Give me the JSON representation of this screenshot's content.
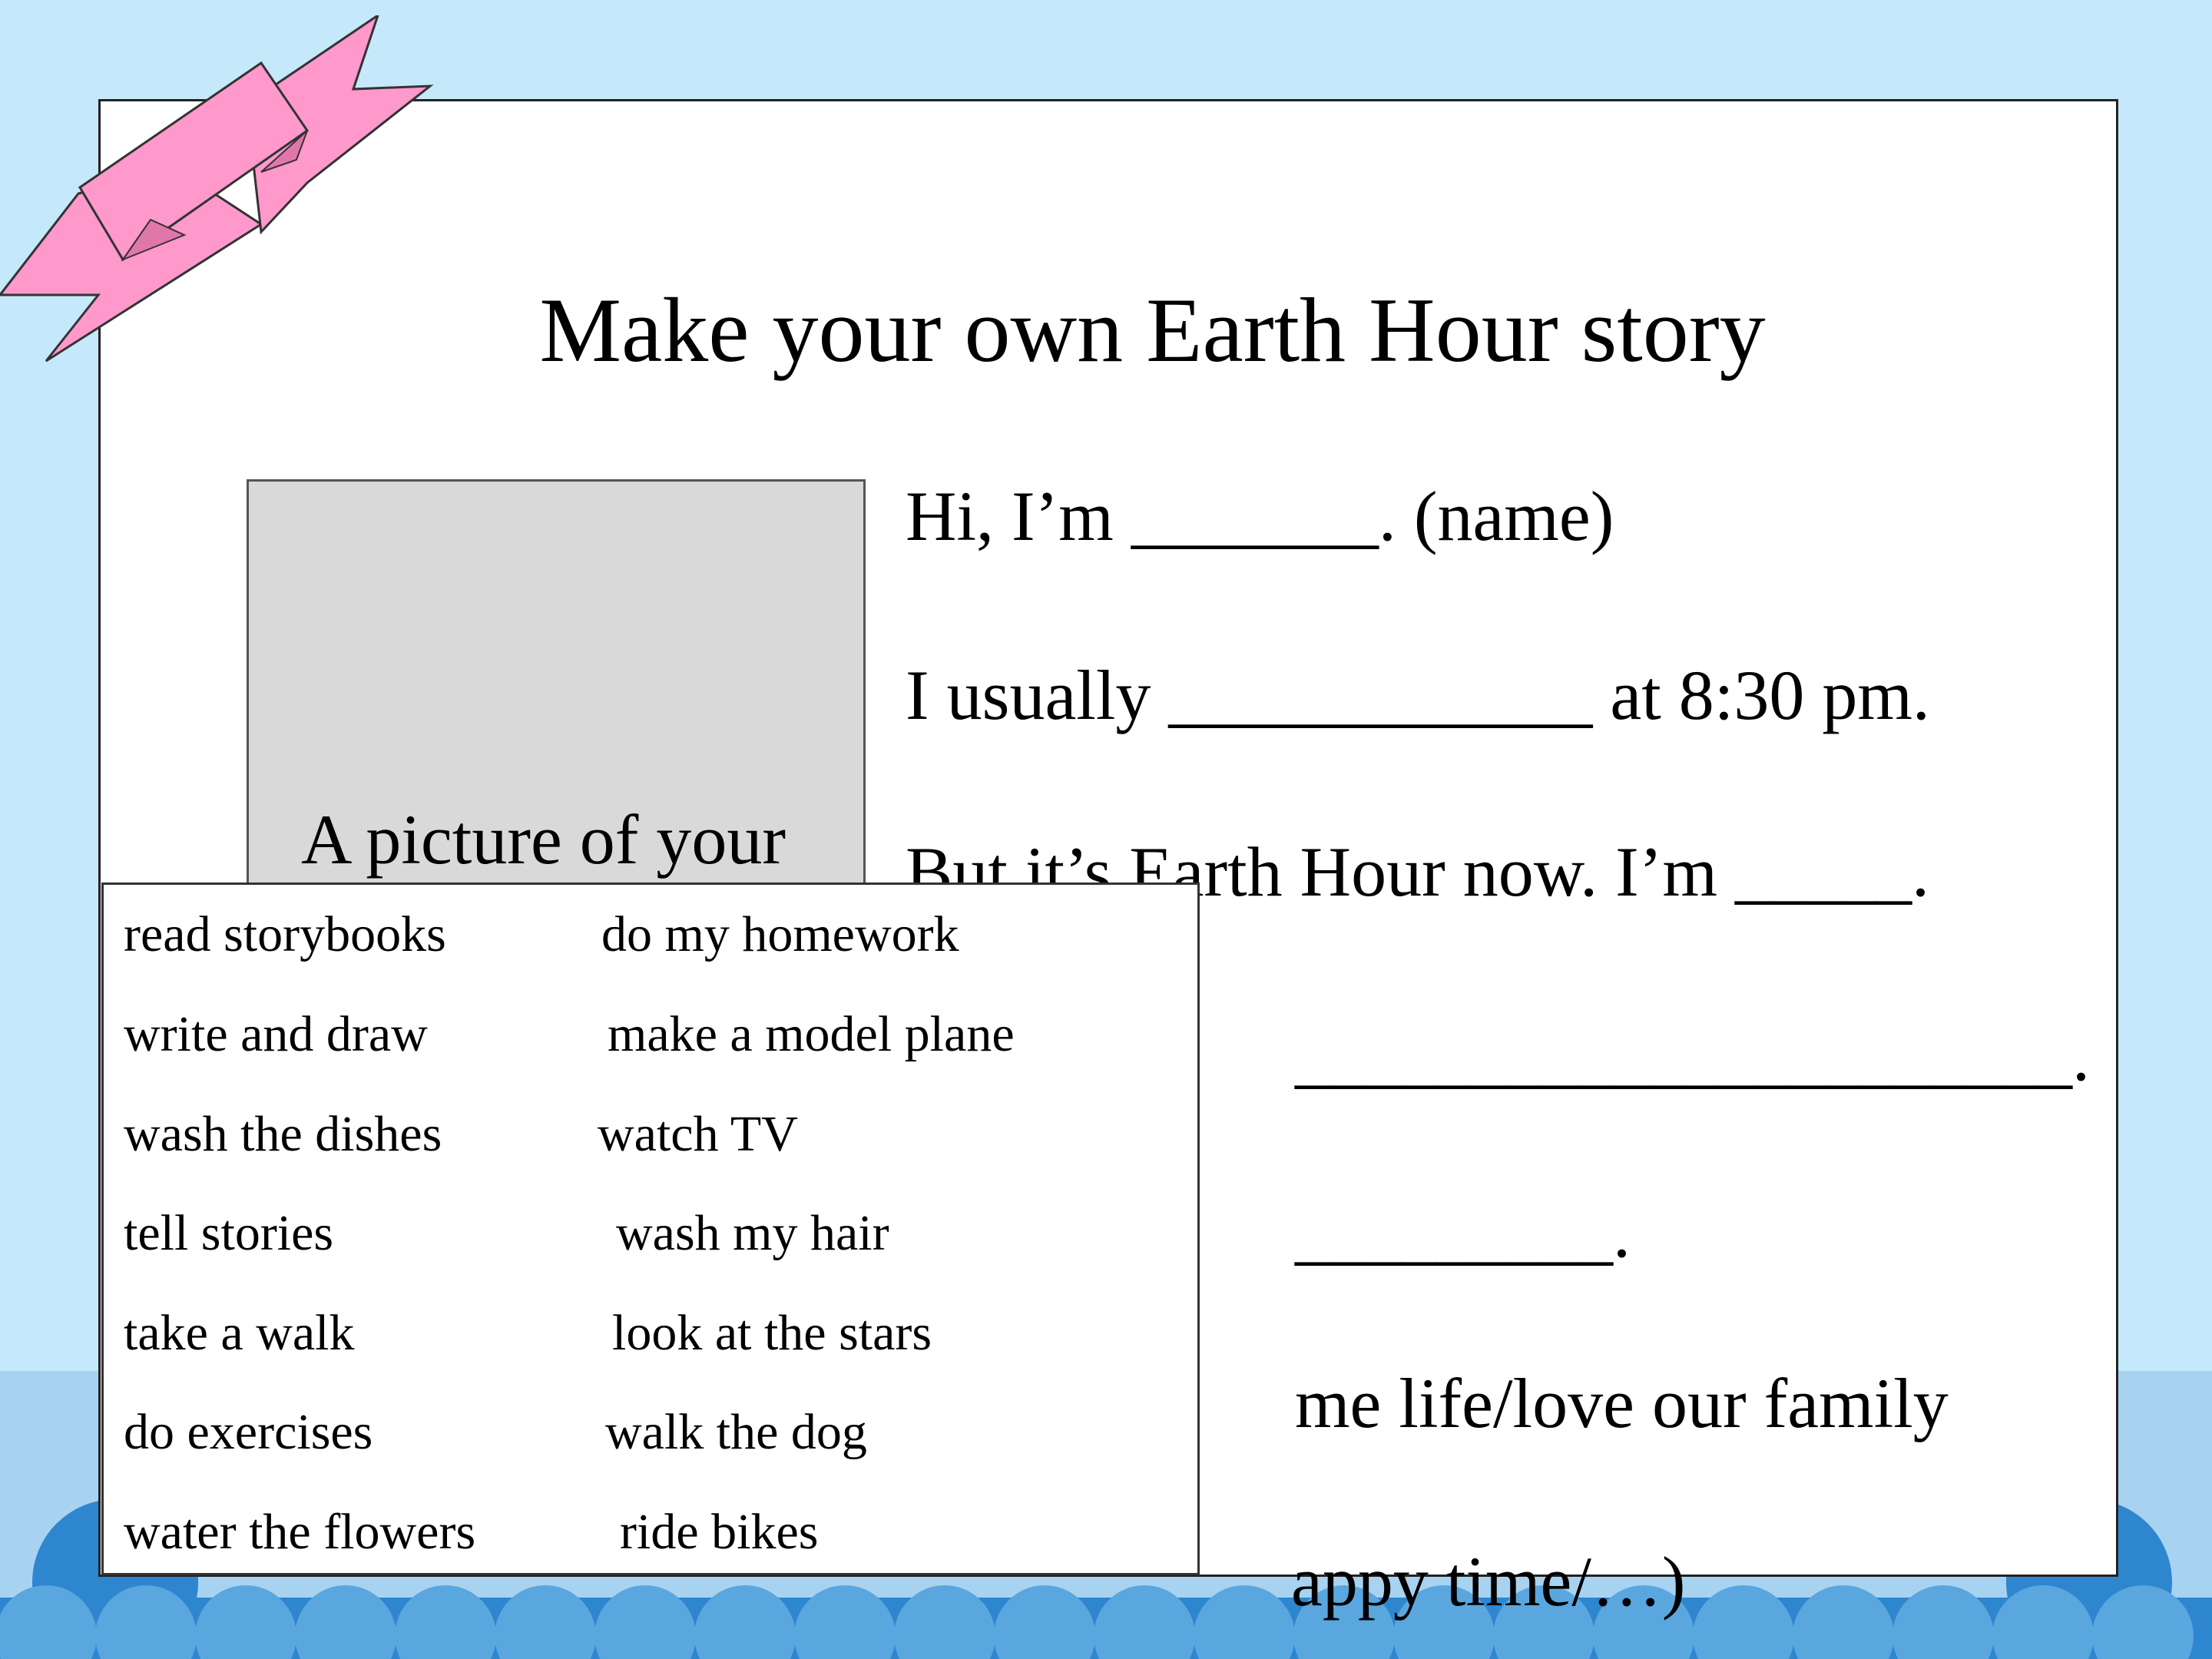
{
  "slide": {
    "title": "Make your own Earth Hour story",
    "picture_caption": "A picture of your family",
    "story_lines": [
      "Hi, I’m _______. (name)",
      "I usually ____________ at 8:30 pm.",
      "But it’s Earth Hour now. I’m _____.",
      "______________________.",
      "_________.",
      "me life/love our family",
      "appy time/…)"
    ]
  },
  "word_bank": {
    "left": [
      "read storybooks",
      "write and draw",
      "wash the dishes",
      "tell stories",
      "take a walk",
      "do exercises",
      "water the flowers"
    ],
    "right": [
      "do my homework",
      "make a model plane",
      "watch TV",
      "wash my hair",
      "look at the stars",
      "walk the dog",
      "ride bikes"
    ]
  },
  "colors": {
    "sky": "#c5e8fa",
    "lower_band": "#a8d3f0",
    "waves": "#2e86cf",
    "ribbon": "#ff99cc",
    "picture_fill": "#d9d9d9"
  }
}
